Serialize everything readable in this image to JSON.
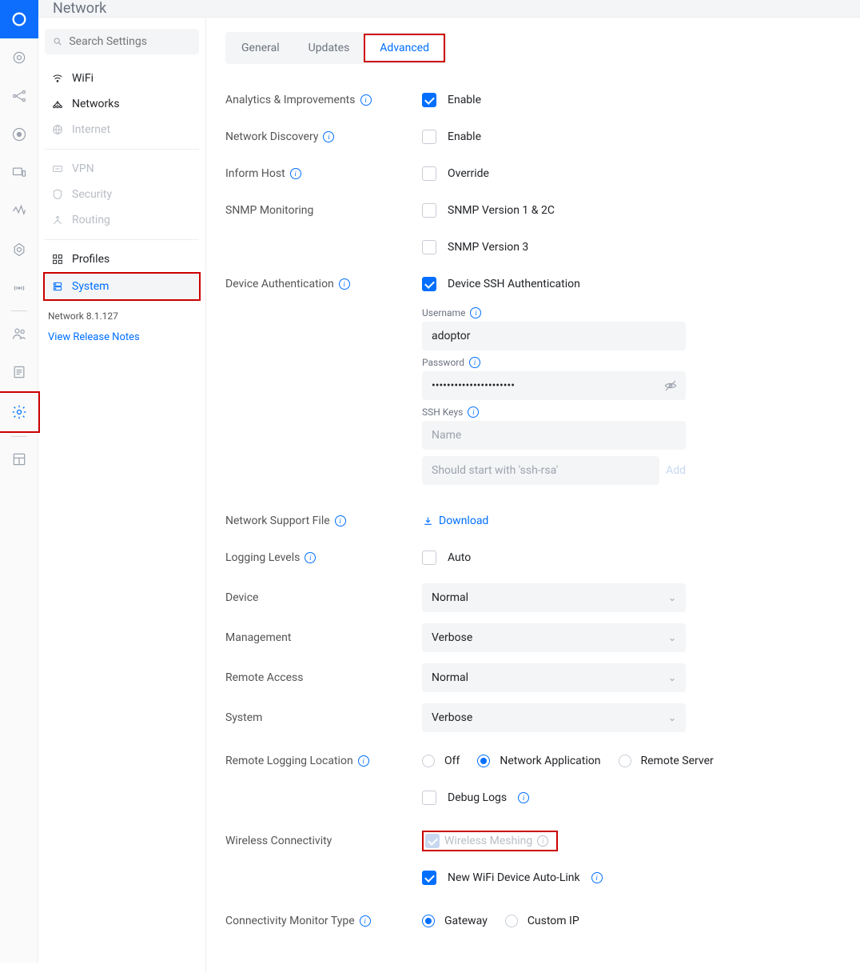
{
  "header": {
    "title": "Network"
  },
  "search": {
    "placeholder": "Search Settings"
  },
  "sidebar": {
    "items": [
      {
        "label": "WiFi"
      },
      {
        "label": "Networks"
      },
      {
        "label": "Internet"
      },
      {
        "label": "VPN"
      },
      {
        "label": "Security"
      },
      {
        "label": "Routing"
      },
      {
        "label": "Profiles"
      },
      {
        "label": "System"
      }
    ],
    "version": "Network 8.1.127",
    "release_link": "View Release Notes"
  },
  "tabs": {
    "general": "General",
    "updates": "Updates",
    "advanced": "Advanced"
  },
  "rows": {
    "analytics": "Analytics & Improvements",
    "enable": "Enable",
    "net_discovery": "Network Discovery",
    "inform_host": "Inform Host",
    "override": "Override",
    "snmp": "SNMP Monitoring",
    "snmp12": "SNMP Version 1 & 2C",
    "snmp3": "SNMP Version 3",
    "dev_auth": "Device Authentication",
    "dev_ssh": "Device SSH Authentication",
    "username_label": "Username",
    "username_value": "adoptor",
    "password_label": "Password",
    "password_value": "••••••••••••••••••••••",
    "sshkeys_label": "SSH Keys",
    "sshkeys_name_ph": "Name",
    "sshkeys_value_ph": "Should start with 'ssh-rsa'",
    "sshkeys_add": "Add",
    "support_file": "Network Support File",
    "download": "Download",
    "logging_levels": "Logging Levels",
    "auto": "Auto",
    "device": "Device",
    "device_val": "Normal",
    "management": "Management",
    "management_val": "Verbose",
    "remote_access": "Remote Access",
    "remote_access_val": "Normal",
    "system": "System",
    "system_val": "Verbose",
    "remote_logging": "Remote Logging Location",
    "off": "Off",
    "net_app": "Network Application",
    "remote_server": "Remote Server",
    "debug_logs": "Debug Logs",
    "wireless_conn": "Wireless Connectivity",
    "wireless_mesh": "Wireless Meshing",
    "autolink": "New WiFi Device Auto-Link",
    "conn_monitor": "Connectivity Monitor Type",
    "gateway": "Gateway",
    "custom_ip": "Custom IP"
  }
}
